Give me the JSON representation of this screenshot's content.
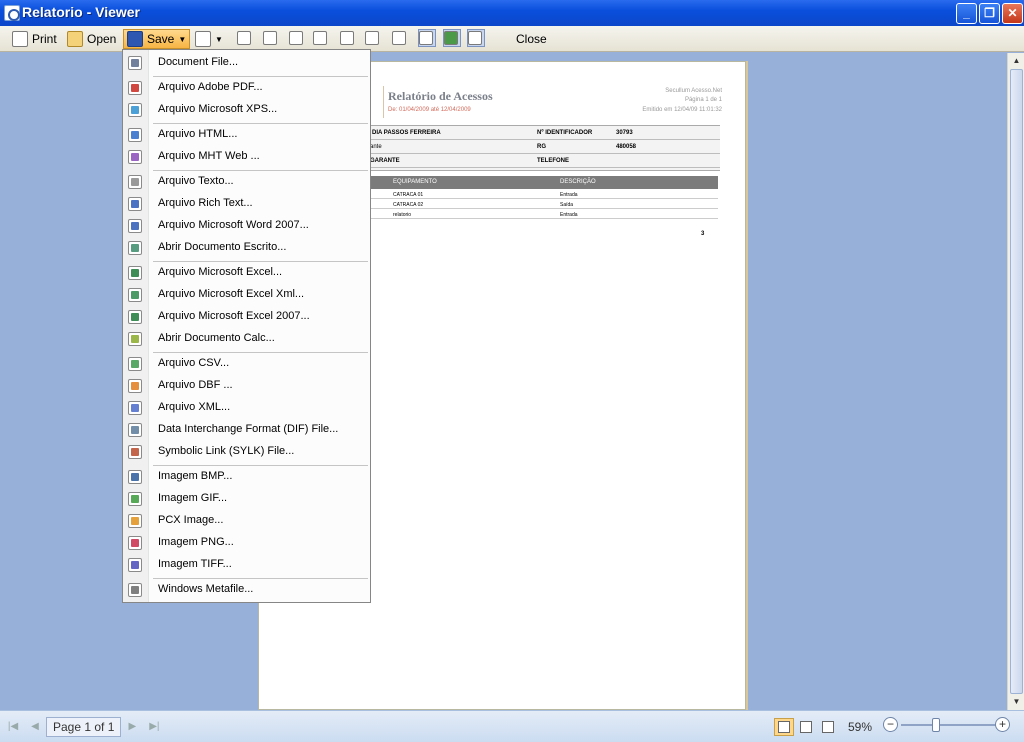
{
  "window": {
    "title": "Relatorio - Viewer"
  },
  "toolbar": {
    "print_label": "Print",
    "open_label": "Open",
    "save_label": "Save",
    "close_label": "Close"
  },
  "report": {
    "title": "Relatório de Acessos",
    "period": "De: 01/04/2009 até 12/04/2009",
    "company": "Secullum Acesso.Net",
    "page_label": "Página 1 de 1",
    "emitted": "Emitido em 12/04/09 11:01:32",
    "info": {
      "name": "DIA PASSOS FERREIRA",
      "id_label": "Nº IDENTIFICADOR",
      "id_value": "30793",
      "type": "ante",
      "rg_label": "RG",
      "rg_value": "480058",
      "role": "GARANTE",
      "phone_label": "TELEFONE"
    },
    "columns": [
      "EQUIPAMENTO",
      "DESCRIÇÃO"
    ],
    "rows": [
      [
        "CATRACA 01",
        "Entrada"
      ],
      [
        "CATRACA 02",
        "Saída"
      ],
      [
        "relatorio",
        "Entrada"
      ]
    ],
    "footer_number": "3"
  },
  "save_menu": [
    {
      "label": "Document File...",
      "icon": "document-icon",
      "color": "#5a6a8a"
    },
    {
      "sep": true
    },
    {
      "label": "Arquivo Adobe PDF...",
      "icon": "pdf-icon",
      "color": "#c8281e"
    },
    {
      "label": "Arquivo Microsoft XPS...",
      "icon": "xps-icon",
      "color": "#2a8fd0"
    },
    {
      "sep": true
    },
    {
      "label": "Arquivo HTML...",
      "icon": "html-icon",
      "color": "#2a6ac8"
    },
    {
      "label": "Arquivo MHT Web ...",
      "icon": "mht-icon",
      "color": "#8a4ab8"
    },
    {
      "sep": true
    },
    {
      "label": "Arquivo Texto...",
      "icon": "text-icon",
      "color": "#8a8a8a"
    },
    {
      "label": "Arquivo Rich Text...",
      "icon": "rtf-icon",
      "color": "#2a5ab8"
    },
    {
      "label": "Arquivo Microsoft Word 2007...",
      "icon": "word-icon",
      "color": "#2b5ab5"
    },
    {
      "label": "Abrir Documento Escrito...",
      "icon": "writer-icon",
      "color": "#3a8a6a"
    },
    {
      "sep": true
    },
    {
      "label": "Arquivo Microsoft Excel...",
      "icon": "excel-icon",
      "color": "#1e7a3a"
    },
    {
      "label": "Arquivo Microsoft Excel Xml...",
      "icon": "excel-xml-icon",
      "color": "#2a8a4a"
    },
    {
      "label": "Arquivo Microsoft Excel 2007...",
      "icon": "excel2007-icon",
      "color": "#1e7a3a"
    },
    {
      "label": "Abrir Documento Calc...",
      "icon": "calc-icon",
      "color": "#8aaa2a"
    },
    {
      "sep": true
    },
    {
      "label": "Arquivo CSV...",
      "icon": "csv-icon",
      "color": "#3a9a4a"
    },
    {
      "label": "Arquivo DBF ...",
      "icon": "dbf-icon",
      "color": "#e07a1a"
    },
    {
      "label": "Arquivo XML...",
      "icon": "xml-icon",
      "color": "#4a6ac8"
    },
    {
      "label": "Data Interchange Format (DIF) File...",
      "icon": "dif-icon",
      "color": "#5a7a9a"
    },
    {
      "label": "Symbolic Link (SYLK) File...",
      "icon": "sylk-icon",
      "color": "#b84a2a"
    },
    {
      "sep": true
    },
    {
      "label": "Imagem BMP...",
      "icon": "bmp-icon",
      "color": "#2a5a9a"
    },
    {
      "label": "Imagem GIF...",
      "icon": "gif-icon",
      "color": "#3a9a3a"
    },
    {
      "label": "PCX Image...",
      "icon": "pcx-icon",
      "color": "#e0901a"
    },
    {
      "label": "Imagem PNG...",
      "icon": "png-icon",
      "color": "#c82a4a"
    },
    {
      "label": "Imagem TIFF...",
      "icon": "tiff-icon",
      "color": "#4a4ab8"
    },
    {
      "sep": true
    },
    {
      "label": "Windows Metafile...",
      "icon": "metafile-icon",
      "color": "#6a6a6a"
    }
  ],
  "statusbar": {
    "page_text": "Page 1 of 1",
    "zoom": "59%",
    "zoom_fraction": 0.35
  }
}
